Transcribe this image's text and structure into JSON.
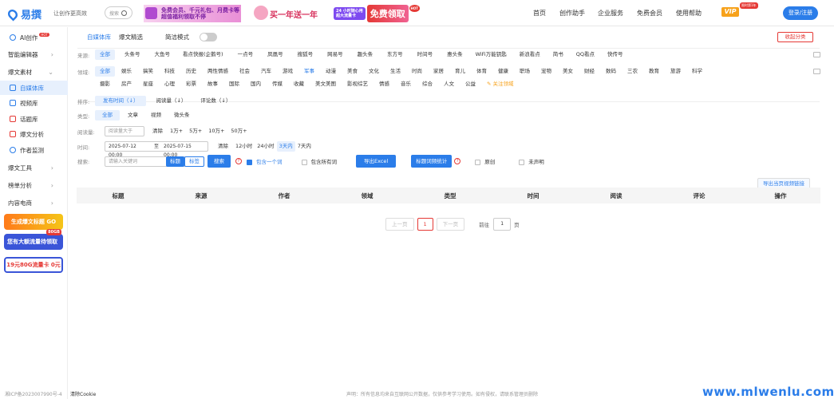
{
  "header": {
    "logo": "易撰",
    "slogan": "让创作更高效",
    "search_placeholder": "搜索",
    "banner1_top": "免费会员、千元礼包、月费卡等",
    "banner1_bottom": "超值福利领取不停",
    "banner2": "买一年送一年",
    "banner3_tag1": "24 小时随心用",
    "banner3_tag2": "超大流量卡",
    "banner3_text": "免费领取",
    "banner3_hot": "HOT",
    "nav": [
      "首页",
      "创作助手",
      "企业服务",
      "免费会员",
      "使用帮助"
    ],
    "vip": "VIP",
    "vip_badge": "限时第1年",
    "login": "登录/注册"
  },
  "sidebar": {
    "items": [
      {
        "label": "AI创作",
        "badge": "HOT",
        "icon": "ai-icon"
      },
      {
        "label": "智能编辑器",
        "icon": ""
      },
      {
        "label": "爆文素材",
        "icon": ""
      },
      {
        "label": "自媒体库",
        "icon": "media-icon"
      },
      {
        "label": "视频库",
        "icon": "video-icon"
      },
      {
        "label": "话题库",
        "icon": "hash-icon"
      },
      {
        "label": "爆文分析",
        "icon": "chart-icon"
      },
      {
        "label": "作者监测",
        "icon": "user-icon"
      },
      {
        "label": "爆文工具",
        "icon": ""
      },
      {
        "label": "榜单分析",
        "icon": ""
      },
      {
        "label": "内容电商",
        "icon": ""
      }
    ],
    "ads": [
      "生成爆文标题 GO",
      "您有大额流量待领取",
      "19元80G流量卡 0元"
    ],
    "ad_badge": "80GB"
  },
  "main": {
    "tabs": [
      "自媒体库",
      "爆文精选"
    ],
    "simple_mode": "简洁模式",
    "collapse": "收起分类",
    "source_label": "来源:",
    "sources": [
      "全部",
      "头条号",
      "大鱼号",
      "看点快报(企鹅号)",
      "一点号",
      "凤凰号",
      "搜狐号",
      "网易号",
      "趣头条",
      "东方号",
      "时间号",
      "惠头条",
      "WiFi万能钥匙",
      "新浪看点",
      "简书",
      "QQ看点",
      "快传号"
    ],
    "field_label": "领域:",
    "fields1": [
      "全部",
      "娱乐",
      "搞笑",
      "科技",
      "历史",
      "两性情感",
      "社会",
      "汽车",
      "游戏",
      "军事",
      "动漫",
      "美食",
      "文化",
      "生活",
      "时尚",
      "家居",
      "育儿",
      "体育",
      "健康",
      "职场",
      "宠物",
      "美女",
      "财经",
      "数码",
      "三农",
      "教育",
      "旅游",
      "科学"
    ],
    "fields2": [
      "摄影",
      "房产",
      "星座",
      "心理",
      "彩票",
      "故事",
      "国际",
      "国内",
      "传媒",
      "收藏",
      "美文美图",
      "影视综艺",
      "情感",
      "音乐",
      "综合",
      "人文",
      "公益"
    ],
    "follow_field": "关注领域",
    "sort_label": "排序:",
    "sorts": [
      "发布时间（↓）",
      "阅读量（↓）",
      "评论数（↓）"
    ],
    "type_label": "类型:",
    "types": [
      "全部",
      "文章",
      "视频",
      "微头条"
    ],
    "read_label": "阅读量:",
    "read_placeholder": "阅读量大于",
    "read_opts": [
      "清除",
      "1万+",
      "5万+",
      "10万+",
      "50万+"
    ],
    "time_label": "时间:",
    "time_from": "2025-07-12 00:00",
    "time_sep": "至",
    "time_to": "2025-07-15 00:00",
    "time_opts": [
      "清除",
      "12小时",
      "24小时",
      "3天内",
      "7天内"
    ],
    "search_label": "搜索:",
    "search_placeholder": "请输入关键词",
    "search_scopes": [
      "标题",
      "标签"
    ],
    "search_btn": "搜索",
    "include_one": "包含一个词",
    "include_all": "包含所有词",
    "export_excel": "导出Excel",
    "title_stats": "标题词频统计",
    "original": "原创",
    "undeclared": "未声明",
    "export_video": "导出当页视频链接",
    "columns": [
      "标题",
      "来源",
      "作者",
      "领域",
      "类型",
      "时间",
      "阅读",
      "评论",
      "操作"
    ],
    "pagination": {
      "prev": "上一页",
      "page": "1",
      "next": "下一页",
      "goto": "前往",
      "goto_val": "1",
      "page_unit": "页"
    }
  },
  "footer": {
    "icp": "湘ICP备2023007990号-4",
    "clear_cookie": "清除Cookie",
    "disclaimer": "声明：所有信息均来自互联网公开数据，仅供参考学习使用。如有侵权，请联系管理员删除",
    "watermark": "www.mlwenlu.com"
  }
}
